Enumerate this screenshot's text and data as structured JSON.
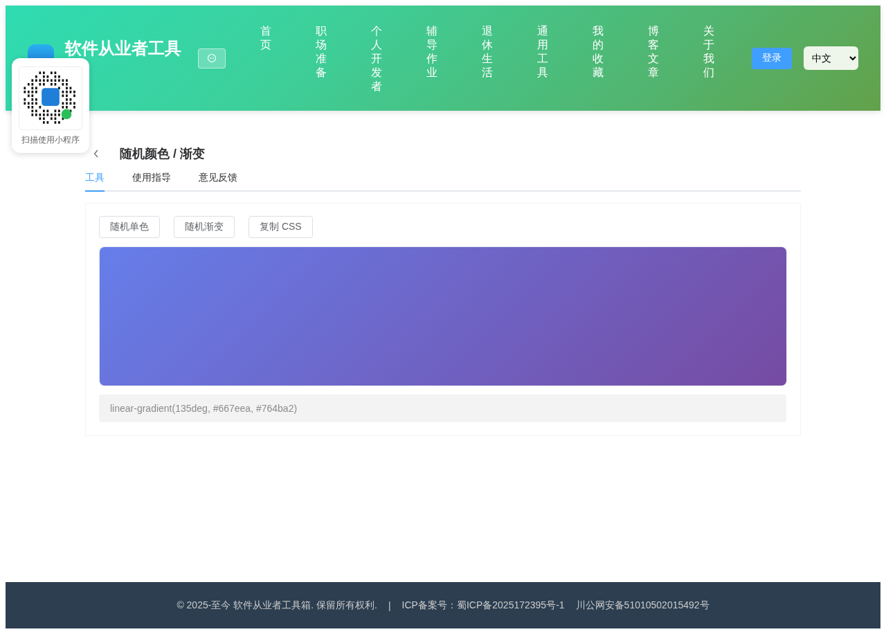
{
  "header": {
    "title": "软件从业者工具",
    "nav": [
      "首页",
      "职场准备",
      "个人开发者",
      "辅导作业",
      "退休生活",
      "通用工具",
      "我的收藏",
      "博客文章",
      "关于我们"
    ],
    "login": "登录",
    "language": "中文"
  },
  "qr_popup": {
    "caption": "扫描使用小程序"
  },
  "page": {
    "title": "随机颜色 / 渐变",
    "tabs": [
      {
        "label": "工具",
        "selected": true
      },
      {
        "label": "使用指导",
        "selected": false
      },
      {
        "label": "意见反馈",
        "selected": false
      }
    ],
    "buttons": [
      "随机单色",
      "随机渐变",
      "复制 CSS"
    ],
    "css_output": "linear-gradient(135deg, #667eea, #764ba2)"
  },
  "footer": {
    "copyright": "© 2025-至今 软件从业者工具箱. 保留所有权利.",
    "separator": "|",
    "icp": "ICP备案号：蜀ICP备2025172395号-1",
    "police": "川公网安备51010502015492号"
  }
}
